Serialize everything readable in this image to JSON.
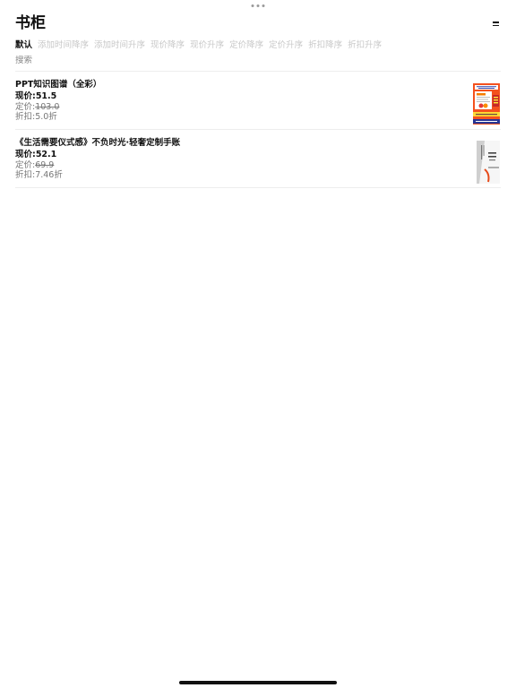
{
  "header": {
    "title": "书柜",
    "menu_icon": "hamburger-menu-icon"
  },
  "sort_options": [
    {
      "label": "默认",
      "active": true
    },
    {
      "label": "添加时间降序",
      "active": false
    },
    {
      "label": "添加时间升序",
      "active": false
    },
    {
      "label": "现价降序",
      "active": false
    },
    {
      "label": "现价升序",
      "active": false
    },
    {
      "label": "定价降序",
      "active": false
    },
    {
      "label": "定价升序",
      "active": false
    },
    {
      "label": "折扣降序",
      "active": false
    },
    {
      "label": "折扣升序",
      "active": false
    }
  ],
  "search": {
    "placeholder": "搜索",
    "value": ""
  },
  "books": [
    {
      "title": "PPT知识图谱（全彩）",
      "price_label": "现价:",
      "price": "51.5",
      "list_price_label": "定价:",
      "list_price": "103.0",
      "discount_label": "折扣:",
      "discount": "5.0折",
      "cover_icon": "book-cover-orange-icon"
    },
    {
      "title": "《生活需要仪式感》不负时光·轻奢定制手账",
      "price_label": "现价:",
      "price": "52.1",
      "list_price_label": "定价:",
      "list_price": "69.9",
      "discount_label": "折扣:",
      "discount": "7.46折",
      "cover_icon": "book-cover-white-icon"
    }
  ],
  "colors": {
    "accent_text": "#111111",
    "inactive_sort": "#c8c8c8",
    "divider": "#ededed"
  }
}
